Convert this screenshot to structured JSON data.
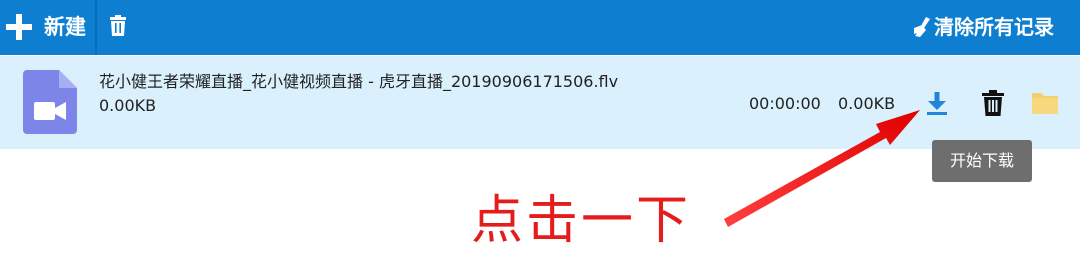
{
  "toolbar": {
    "new_label": "新建",
    "clear_label": "清除所有记录",
    "bg_color": "#0e7fd0"
  },
  "record": {
    "filename": "花小健王者荣耀直播_花小健视频直播 - 虎牙直播_20190906171506.flv",
    "filesize": "0.00KB",
    "duration": "00:00:00",
    "recv_size": "0.00KB",
    "row_bg": "#daf0fd"
  },
  "actions": {
    "download_icon": "download-icon",
    "delete_icon": "trash-icon",
    "folder_icon": "folder-icon"
  },
  "tooltip": {
    "text": "开始下载"
  },
  "annotation": {
    "text": "点击一下",
    "color": "#e51c1c"
  }
}
